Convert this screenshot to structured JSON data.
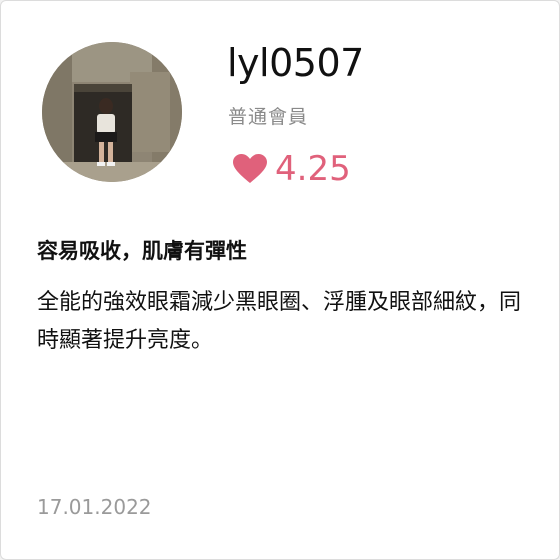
{
  "user": {
    "name": "lyl0507",
    "membership": "普通會員"
  },
  "rating": {
    "icon": "heart-icon",
    "value": "4.25",
    "color": "#e0617b"
  },
  "review": {
    "title": "容易吸收，肌膚有彈性",
    "body": "全能的強效眼霜減少黑眼圈、浮腫及眼部細紋，同時顯著提升亮度。",
    "date": "17.01.2022"
  }
}
